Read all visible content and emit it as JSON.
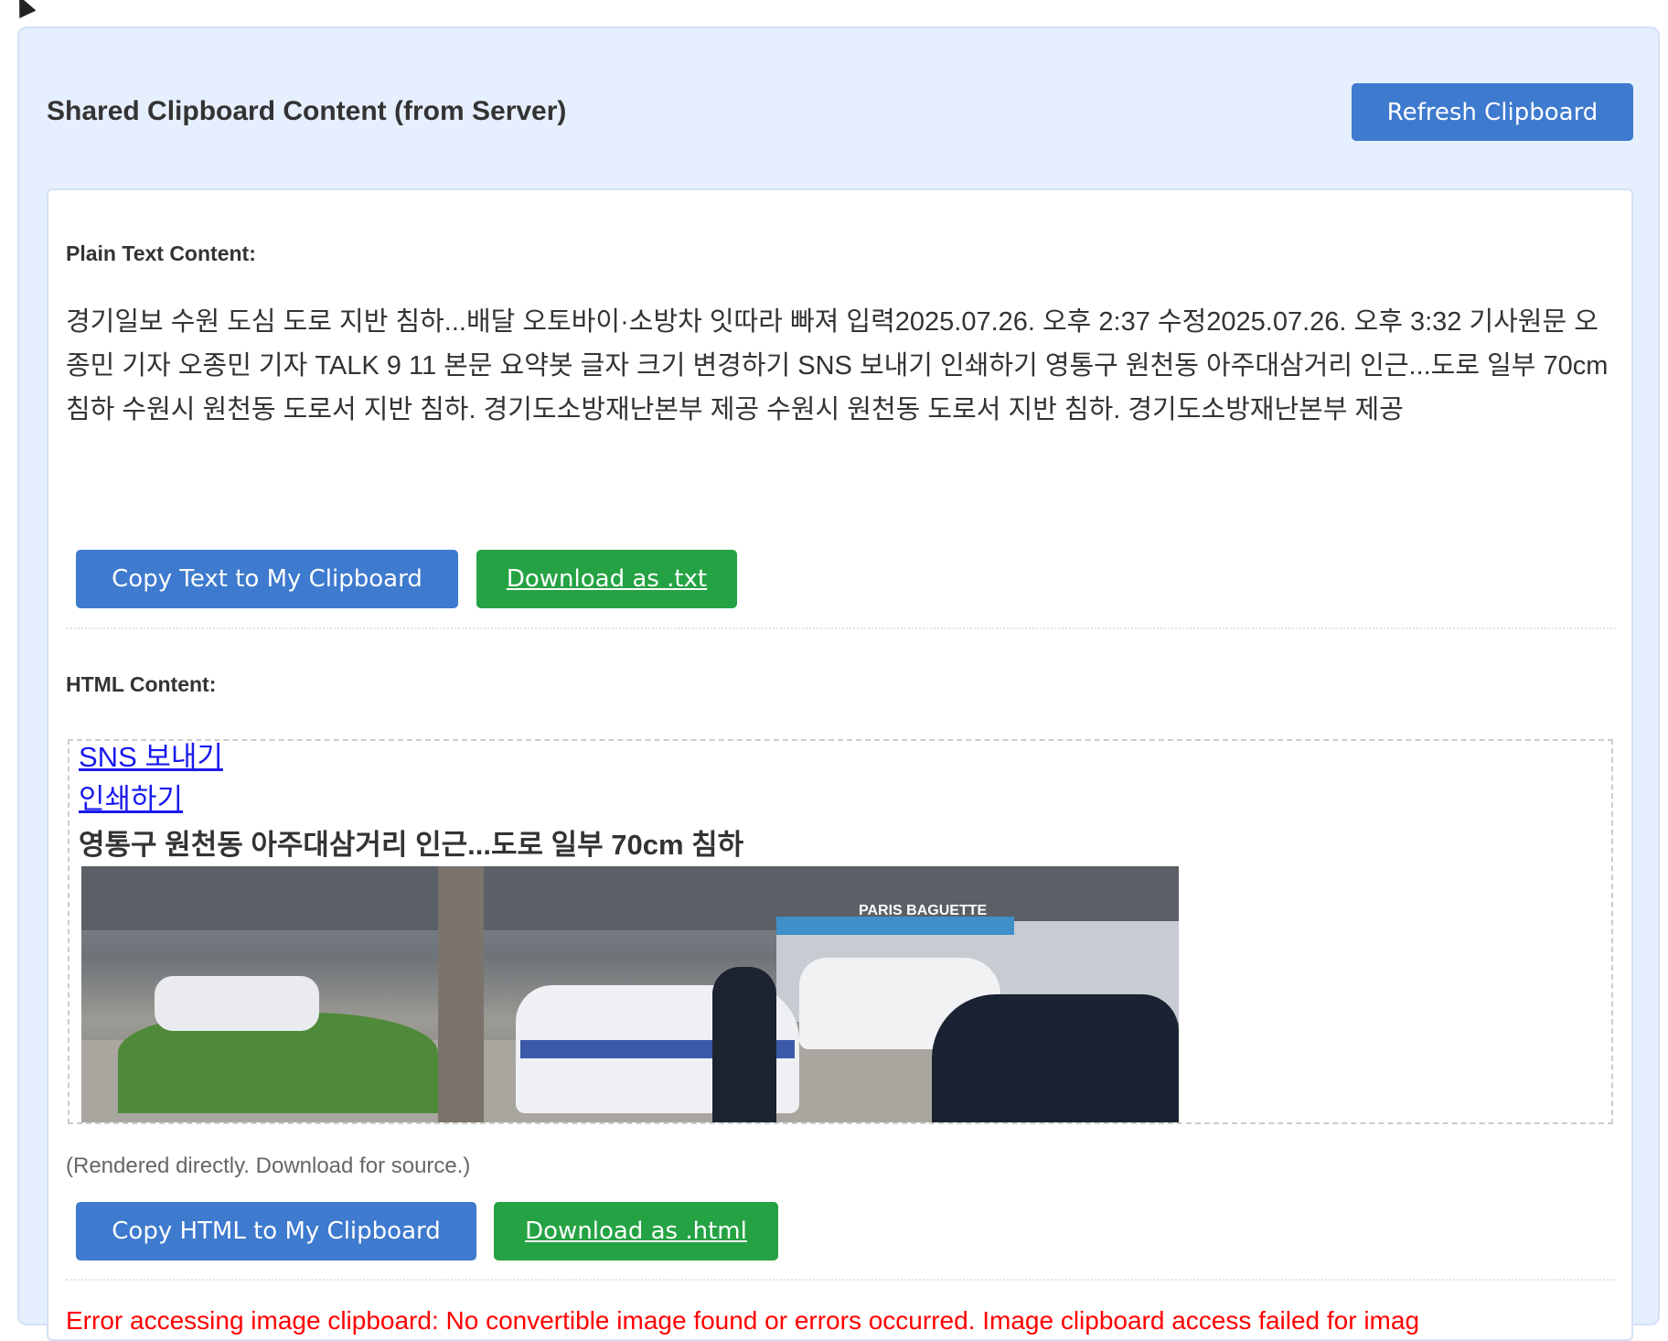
{
  "header": {
    "title": "Shared Clipboard Content (from Server)",
    "refresh_label": "Refresh Clipboard"
  },
  "plain": {
    "label": "Plain Text Content:",
    "text": "경기일보 수원 도심 도로 지반 침하...배달 오토바이·소방차 잇따라 빠져 입력2025.07.26. 오후 2:37 수정2025.07.26. 오후 3:32 기사원문 오종민 기자 오종민 기자 TALK 9 11 본문 요약봇 글자 크기 변경하기 SNS 보내기 인쇄하기 영통구 원천동 아주대삼거리 인근...도로 일부 70cm 침하 수원시 원천동 도로서 지반 침하. 경기도소방재난본부 제공 수원시 원천동 도로서 지반 침하. 경기도소방재난본부 제공",
    "copy_label": "Copy Text to My Clipboard",
    "download_label": "Download as .txt"
  },
  "html": {
    "label": "HTML Content:",
    "link1": "SNS 보내기",
    "link2": "인쇄하기",
    "heading": "영통구 원천동 아주대삼거리 인근...도로 일부 70cm 침하",
    "image_sign": "PARIS BAGUETTE",
    "note": "(Rendered directly. Download for source.)",
    "copy_label": "Copy HTML to My Clipboard",
    "download_label": "Download as .html"
  },
  "error": {
    "text": "Error accessing image clipboard: No convertible image found or errors occurred. Image clipboard access failed for imag"
  },
  "colors": {
    "primary": "#3e7ace",
    "success": "#25a344",
    "error": "#ff0000",
    "panel": "#e6effd"
  }
}
